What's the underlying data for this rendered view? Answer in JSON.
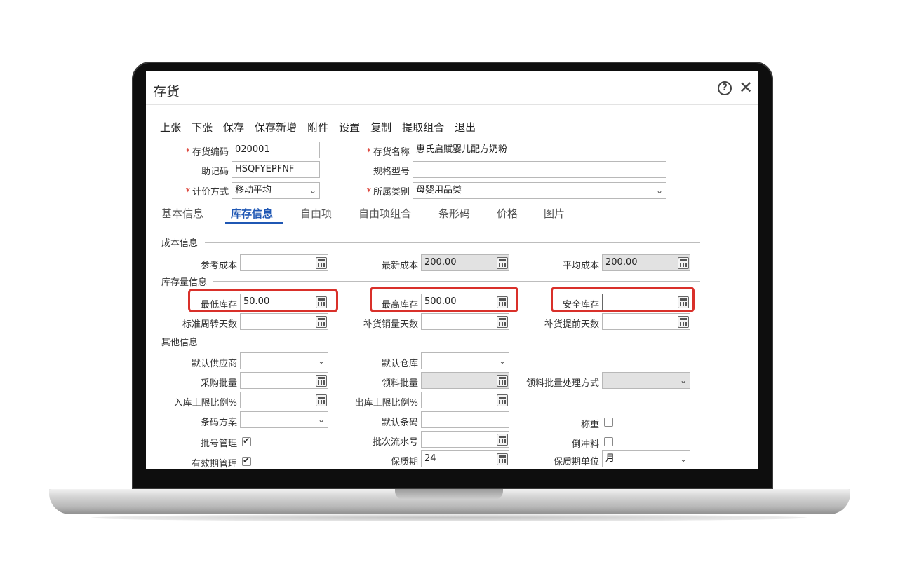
{
  "window": {
    "title": "存货"
  },
  "toolbar": [
    "上张",
    "下张",
    "保存",
    "保存新增",
    "附件",
    "设置",
    "复制",
    "提取组合",
    "退出"
  ],
  "header_fields": {
    "code_label": "存货编码",
    "code_value": "020001",
    "name_label": "存货名称",
    "name_value": "惠氏启赋婴儿配方奶粉",
    "mnemonic_label": "助记码",
    "mnemonic_value": "HSQFYEPFNF",
    "spec_label": "规格型号",
    "spec_value": "",
    "pricing_label": "计价方式",
    "pricing_value": "移动平均",
    "category_label": "所属类别",
    "category_value": "母婴用品类"
  },
  "tabs": [
    "基本信息",
    "库存信息",
    "自由项",
    "自由项组合",
    "条形码",
    "价格",
    "图片"
  ],
  "active_tab": "库存信息",
  "sections": {
    "cost": "成本信息",
    "stock": "库存量信息",
    "other": "其他信息"
  },
  "cost_fields": {
    "ref_cost_label": "参考成本",
    "ref_cost_value": "",
    "latest_cost_label": "最新成本",
    "latest_cost_value": "200.00",
    "avg_cost_label": "平均成本",
    "avg_cost_value": "200.00"
  },
  "stock_fields": {
    "min_label": "最低库存",
    "min_value": "50.00",
    "max_label": "最高库存",
    "max_value": "500.00",
    "safety_label": "安全库存",
    "safety_value": "",
    "turnover_label": "标准周转天数",
    "turnover_value": "",
    "replenish_days_label": "补货销量天数",
    "replenish_days_value": "",
    "lead_days_label": "补货提前天数",
    "lead_days_value": ""
  },
  "other_fields": {
    "supplier_label": "默认供应商",
    "supplier_value": "",
    "warehouse_label": "默认仓库",
    "warehouse_value": "",
    "purchase_batch_label": "采购批量",
    "purchase_batch_value": "",
    "pick_batch_label": "领料批量",
    "pick_batch_value": "",
    "pick_method_label": "领料批量处理方式",
    "pick_method_value": "",
    "in_limit_label": "入库上限比例%",
    "in_limit_value": "",
    "out_limit_label": "出库上限比例%",
    "out_limit_value": "",
    "barcode_scheme_label": "条码方案",
    "barcode_scheme_value": "",
    "default_barcode_label": "默认条码",
    "default_barcode_value": "",
    "weigh_label": "称重",
    "weigh_checked": false,
    "batch_mgmt_label": "批号管理",
    "batch_mgmt_checked": true,
    "batch_serial_label": "批次流水号",
    "batch_serial_value": "",
    "backflush_label": "倒冲料",
    "backflush_checked": false,
    "expiry_mgmt_label": "有效期管理",
    "expiry_mgmt_checked": true,
    "shelf_life_label": "保质期",
    "shelf_life_value": "24",
    "shelf_unit_label": "保质期单位",
    "shelf_unit_value": "月"
  },
  "colors": {
    "accent": "#1f57b4",
    "highlight": "#d9302a",
    "required": "#d93025"
  }
}
